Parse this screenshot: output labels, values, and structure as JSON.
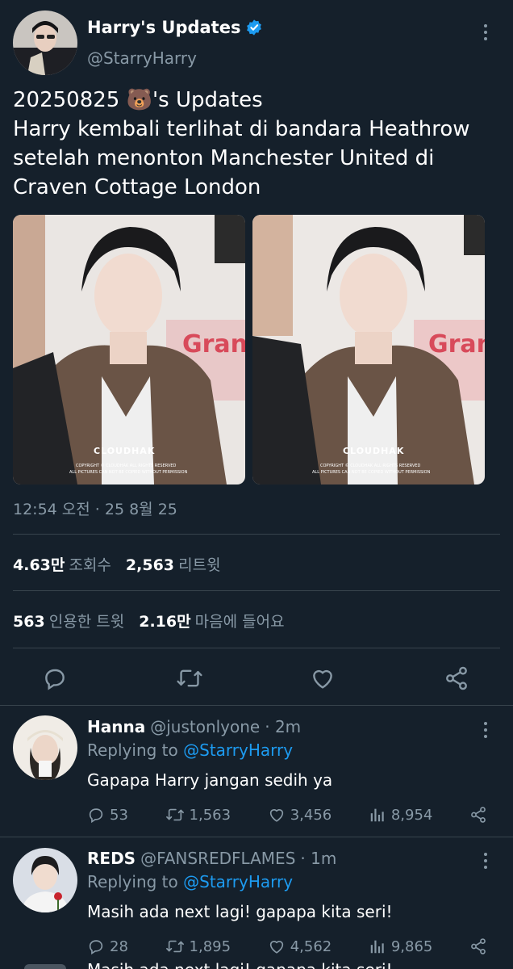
{
  "tweet": {
    "author_name": "Harry's Updates",
    "author_handle": "@StarryHarry",
    "text_line1_prefix": "20250825 ",
    "text_line1_emoji": "🐻",
    "text_line1_suffix": "'s Updates",
    "text_line2": "Harry kembali terlihat di bandara Heathrow",
    "text_line3": "setelah menonton Manchester United di",
    "text_line4": "Craven Cottage London",
    "photo_watermark": "CLOUDHAK",
    "photo_copyright_1": "COPYRIGHT © CLOUDHAK ALL RIGHTS RESERVED",
    "photo_copyright_2": "ALL PICTURES CAN NOT BE COPIED WITHOUT PERMISSION",
    "timestamp": "12:54 오전 · 25 8월 25",
    "views_count": "4.63만",
    "views_label": "조회수",
    "retweets_count": "2,563",
    "retweets_label": "리트윗",
    "quotes_count": "563",
    "quotes_label": "인용한 트윗",
    "likes_count": "2.16만",
    "likes_label": "마음에 들어요"
  },
  "replies": [
    {
      "name": "Hanna",
      "handle": "@justonlyone",
      "time": "· 2m",
      "replying_prefix": "Replying to",
      "replying_to": "@StarryHarry",
      "text": "Gapapa Harry jangan sedih ya",
      "comments": "53",
      "retweets": "1,563",
      "likes": "3,456",
      "views": "8,954"
    },
    {
      "name": "REDS",
      "handle": "@FANSREDFLAMES",
      "time": "· 1m",
      "replying_prefix": "Replying to",
      "replying_to": "@StarryHarry",
      "text": "Masih ada next lagi! gapapa kita seri!",
      "comments": "28",
      "retweets": "1,895",
      "likes": "4,562",
      "views": "9,865"
    }
  ],
  "partial_next_reply": "Masih ada next lagi! gapapa kita seri!",
  "colors": {
    "background": "#15202b",
    "secondary_text": "#8899a6",
    "accent": "#1d9bf0",
    "divider": "#38444d"
  }
}
